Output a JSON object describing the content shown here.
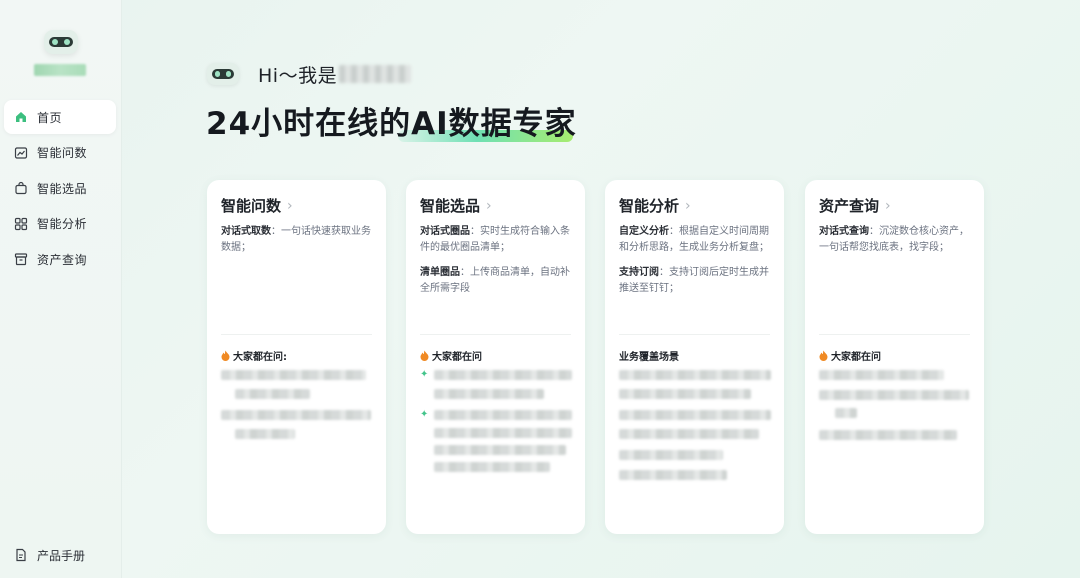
{
  "sidebar": {
    "items": [
      {
        "label": "首页",
        "icon": "home-icon",
        "active": true
      },
      {
        "label": "智能问数",
        "icon": "line-chart-icon",
        "active": false
      },
      {
        "label": "智能选品",
        "icon": "shopping-bag-icon",
        "active": false
      },
      {
        "label": "智能分析",
        "icon": "grid-icon",
        "active": false
      },
      {
        "label": "资产查询",
        "icon": "archive-icon",
        "active": false
      }
    ],
    "footer": {
      "label": "产品手册",
      "icon": "document-icon"
    }
  },
  "hero": {
    "greeting": "Hi～我是",
    "headline": "24小时在线的AI数据专家"
  },
  "cards": [
    {
      "title": "智能问数",
      "items": [
        {
          "label": "对话式取数",
          "text": "：一句话快速获取业务数据；"
        }
      ],
      "section_title": "大家都在问:"
    },
    {
      "title": "智能选品",
      "items": [
        {
          "label": "对话式圈品",
          "text": "：实时生成符合输入条件的最优圈品清单；"
        },
        {
          "label": "清单圈品",
          "text": "：上传商品清单，自动补全所需字段"
        }
      ],
      "section_title": "大家都在问"
    },
    {
      "title": "智能分析",
      "items": [
        {
          "label": "自定义分析",
          "text": "：根据自定义时间周期和分析思路，生成业务分析复盘；"
        },
        {
          "label": "支持订阅",
          "text": "：支持订阅后定时生成并推送至钉钉；"
        }
      ],
      "section_title": "业务覆盖场景"
    },
    {
      "title": "资产查询",
      "items": [
        {
          "label": "对话式查询",
          "text": "：沉淀数仓核心资产，一句话帮您找底表，找字段；"
        }
      ],
      "section_title": "大家都在问"
    }
  ],
  "colors": {
    "accent": "#43c48b",
    "underline_start": "#6fe0b4",
    "underline_end": "#a7ec6f",
    "fire": "#f08a24"
  }
}
